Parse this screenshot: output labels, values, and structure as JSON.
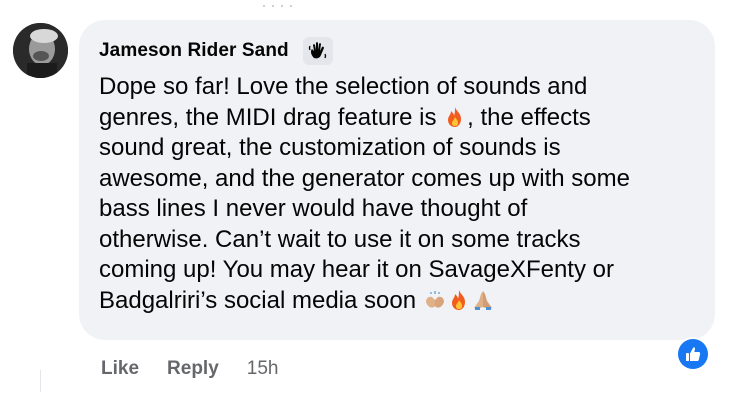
{
  "comment": {
    "author": "Jameson Rider Sand",
    "author_badge_icon": "waving-hand-icon",
    "text_lines": [
      "Dope so far! Love the selection of sounds and",
      "genres, the MIDI drag feature is ",
      ", the effects",
      "sound great, the customization of sounds is",
      "awesome, and the generator comes up with some",
      "bass lines I never would have thought of",
      "otherwise. Can’t wait to use it on some tracks",
      "coming up! You may hear it on SavageXFenty or",
      "Badgalriri’s social media soon "
    ],
    "reaction_icon": "like-icon"
  },
  "actions": {
    "like_label": "Like",
    "reply_label": "Reply",
    "timestamp": "15h"
  },
  "colors": {
    "bubble": "#f0f2f5",
    "text": "#050505",
    "secondary_text": "#65676b",
    "like_blue": "#1877f2"
  }
}
